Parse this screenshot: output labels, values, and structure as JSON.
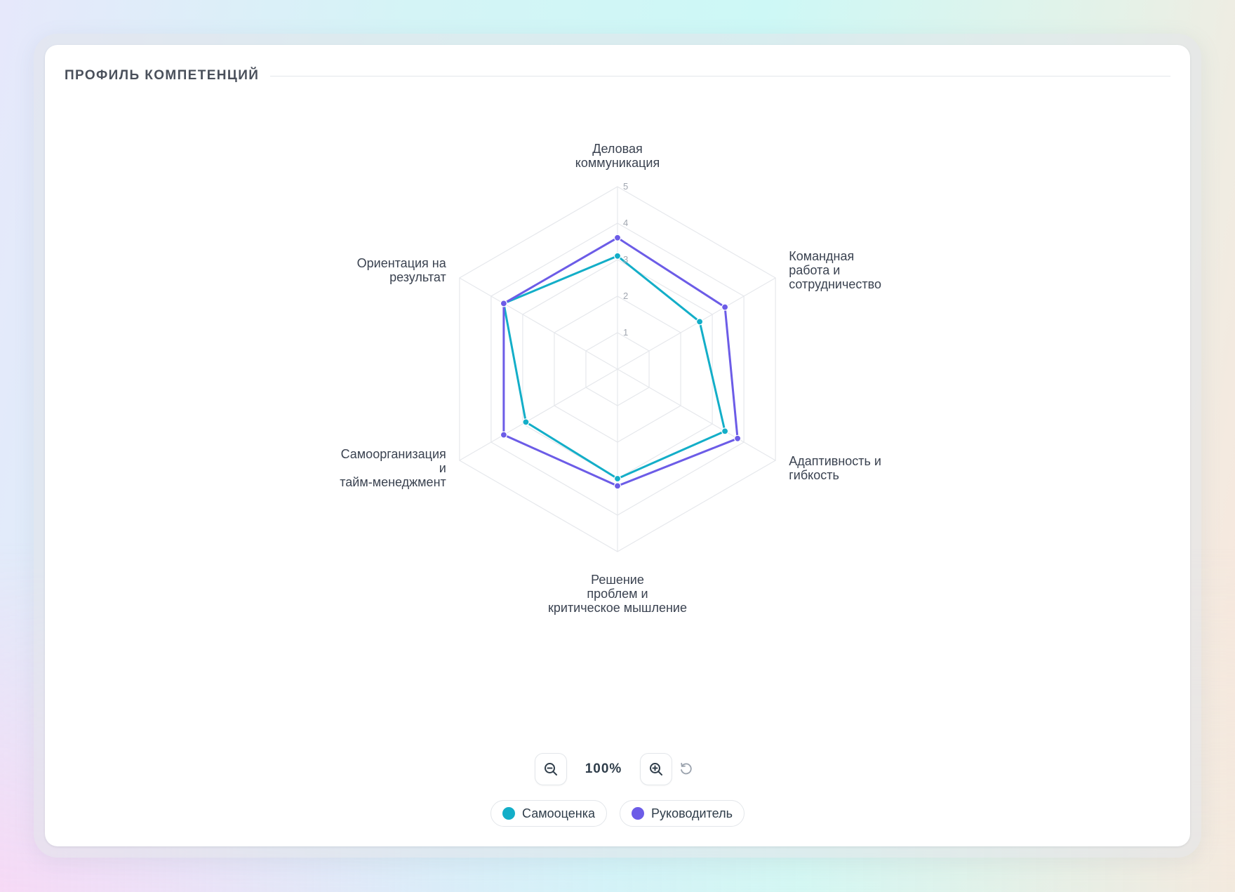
{
  "card": {
    "title": "ПРОФИЛЬ КОМПЕТЕНЦИЙ"
  },
  "chart_data": {
    "type": "radar",
    "categories": [
      [
        "Деловая",
        "коммуникация"
      ],
      [
        "Командная",
        "работа и",
        "сотрудничество"
      ],
      [
        "Адаптивность и",
        "гибкость"
      ],
      [
        "Решение",
        "проблем и",
        "критическое мышление"
      ],
      [
        "Самоорганизация",
        "и",
        "тайм-менеджмент"
      ],
      [
        "Ориентация на",
        "результат"
      ]
    ],
    "scale": {
      "min": 0,
      "max": 5,
      "ticks": [
        "1",
        "2",
        "3",
        "4",
        "5"
      ]
    },
    "series": [
      {
        "name": "Самооценка",
        "color": "#13aec8",
        "values": [
          3.1,
          2.6,
          3.4,
          3.0,
          2.9,
          3.6
        ]
      },
      {
        "name": "Руководитель",
        "color": "#6c5ce7",
        "values": [
          3.6,
          3.4,
          3.8,
          3.2,
          3.6,
          3.6
        ]
      }
    ],
    "grid": true,
    "legend_position": "bottom"
  },
  "zoom": {
    "level": "100%"
  },
  "icons": {
    "zoom_out": "zoom-out-icon",
    "zoom_in": "zoom-in-icon",
    "reset": "reset-icon"
  }
}
